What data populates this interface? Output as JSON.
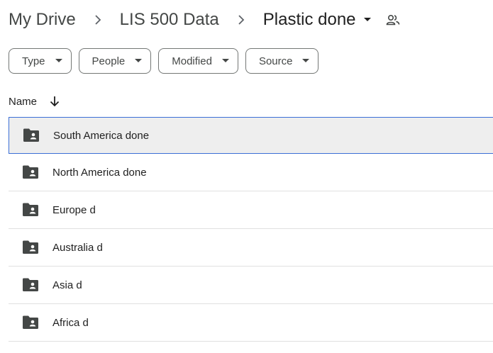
{
  "breadcrumb": {
    "items": [
      {
        "label": "My Drive"
      },
      {
        "label": "LIS 500 Data"
      },
      {
        "label": "Plastic done"
      }
    ],
    "separator_icon": "chevron-right-icon",
    "current_caret_icon": "caret-down-icon",
    "shared_icon": "people-icon"
  },
  "filters": [
    {
      "label": "Type"
    },
    {
      "label": "People"
    },
    {
      "label": "Modified"
    },
    {
      "label": "Source"
    }
  ],
  "list": {
    "column_name": "Name",
    "sort_icon": "arrow-down-icon",
    "rows": [
      {
        "name": "South America done",
        "icon": "shared-folder-icon",
        "selected": true
      },
      {
        "name": "North America done",
        "icon": "shared-folder-icon"
      },
      {
        "name": "Europe d",
        "icon": "shared-folder-icon"
      },
      {
        "name": "Australia d",
        "icon": "shared-folder-icon"
      },
      {
        "name": "Asia d",
        "icon": "shared-folder-icon"
      },
      {
        "name": "Africa d",
        "icon": "shared-folder-icon"
      }
    ]
  },
  "colors": {
    "selected_row_bg": "#eeeeee",
    "selected_row_border": "#3b6ed6",
    "divider": "#e0e0e0",
    "icon": "#444746"
  }
}
